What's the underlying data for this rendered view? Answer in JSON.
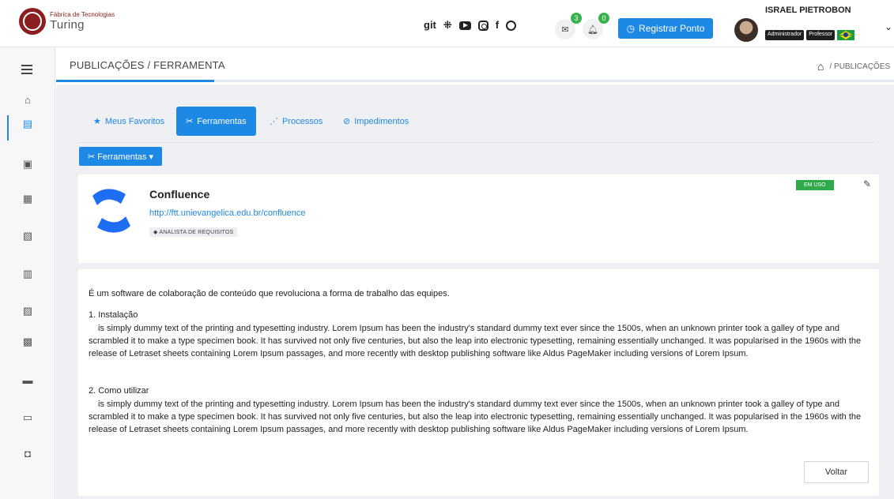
{
  "brand": {
    "small_text": "Fábrica de Tecnologias",
    "name": "Turing"
  },
  "socials": {
    "git": "git",
    "slack": "⁜",
    "facebook": "f"
  },
  "notifications": {
    "messages_count": "3",
    "alerts_count": "0"
  },
  "header_actions": {
    "register_label": "Registrar Ponto",
    "register_icon": "◷"
  },
  "user": {
    "name": "ISRAEL PIETROBON",
    "roles": [
      "Administrador",
      "Professor"
    ]
  },
  "page": {
    "title": "PUBLICAÇÕES / FERRAMENTA",
    "breadcrumb": "/ PUBLICAÇÕES"
  },
  "tabs": [
    {
      "label": "Meus Favoritos",
      "icon": "★"
    },
    {
      "label": "Ferramentas",
      "icon": "✂"
    },
    {
      "label": "Processos",
      "icon": "⋰"
    },
    {
      "label": "Impedimentos",
      "icon": "⊘"
    }
  ],
  "dropdown": {
    "label": "Ferramentas ▾",
    "icon": "✂"
  },
  "tool": {
    "name": "Confluence",
    "url": "http://ftt.unievangelica.edu.br/confluence",
    "tag": "ANALISTA DE REQUISITOS",
    "status": "EM USO"
  },
  "description": {
    "intro": "É um software de colaboração de conteúdo que revoluciona a forma de trabalho das equipes.",
    "sections": [
      {
        "title": "1. Instalação",
        "body": "is simply dummy text of the printing and typesetting industry. Lorem Ipsum has been the industry's standard dummy text ever since the 1500s, when an unknown printer took a galley of type and scrambled it to make a type specimen book. It has survived not only five centuries, but also the leap into electronic typesetting, remaining essentially unchanged. It was popularised in the 1960s with the release of Letraset sheets containing Lorem Ipsum passages, and more recently with desktop publishing software like Aldus PageMaker including versions of Lorem Ipsum."
      },
      {
        "title": "2. Como utilizar",
        "body": "is simply dummy text of the printing and typesetting industry. Lorem Ipsum has been the industry's standard dummy text ever since the 1500s, when an unknown printer took a galley of type and scrambled it to make a type specimen book. It has survived not only five centuries, but also the leap into electronic typesetting, remaining essentially unchanged. It was popularised in the 1960s with the release of Letraset sheets containing Lorem Ipsum passages, and more recently with desktop publishing software like Aldus PageMaker including versions of Lorem Ipsum."
      }
    ]
  },
  "footer": {
    "back_label": "Voltar"
  },
  "colors": {
    "primary": "#1e88e5",
    "success": "#2eaa4a",
    "brand": "#8b1e1e"
  }
}
